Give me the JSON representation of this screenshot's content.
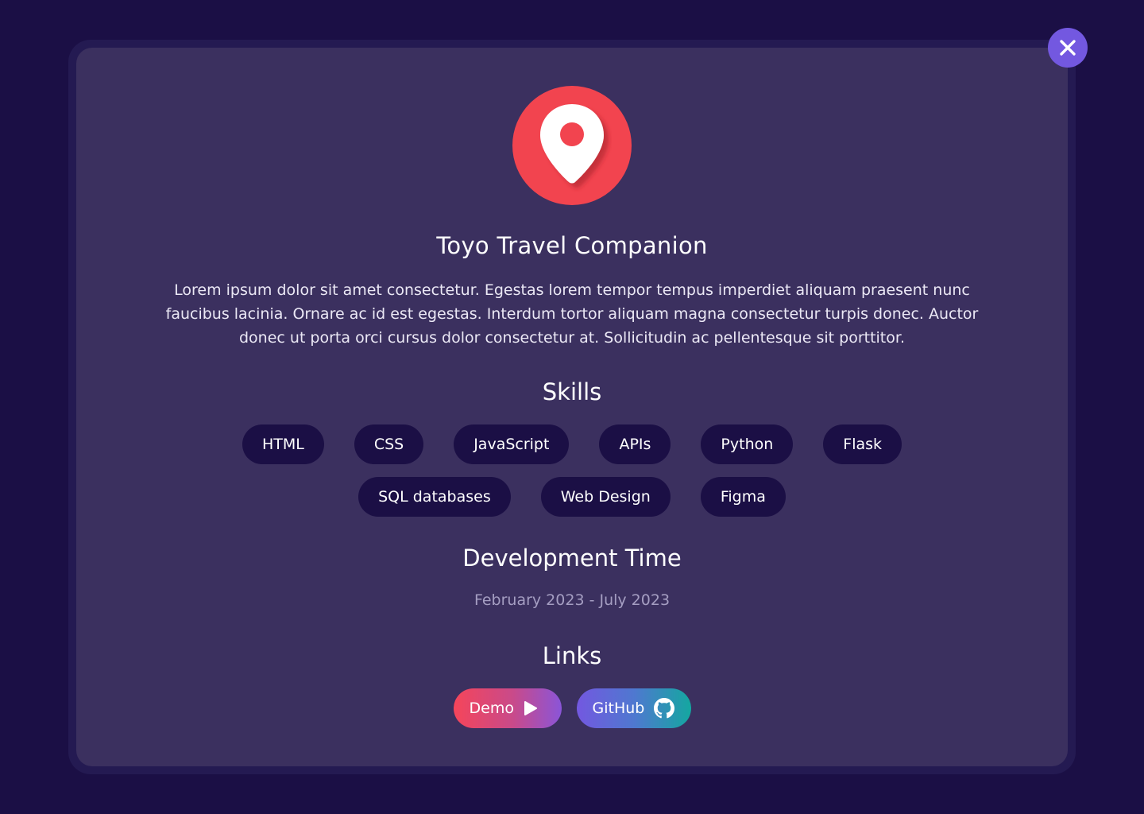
{
  "project": {
    "title": "Toyo Travel Companion",
    "description": "Lorem ipsum dolor sit amet consectetur. Egestas lorem tempor tempus imperdiet aliquam praesent nunc faucibus lacinia. Ornare ac id est egestas. Interdum tortor aliquam magna consectetur turpis donec. Auctor donec ut porta orci cursus dolor consectetur at. Sollicitudin ac pellentesque sit porttitor.",
    "logo_icon": "map-pin-icon"
  },
  "skills": {
    "heading": "Skills",
    "row1": [
      "HTML",
      "CSS",
      "JavaScript",
      "APIs",
      "Python",
      "Flask"
    ],
    "row2": [
      "SQL databases",
      "Web Design",
      "Figma"
    ]
  },
  "development": {
    "heading": "Development Time",
    "period": "February 2023 - July 2023"
  },
  "links": {
    "heading": "Links",
    "demo_label": "Demo",
    "github_label": "GitHub"
  },
  "colors": {
    "page_background": "#1b0f45",
    "modal_background": "#3b305f",
    "accent": "#7358e0",
    "logo_red": "#f2444f",
    "chip_background": "#1b0f45"
  },
  "icons": {
    "close": "close-icon",
    "demo": "play-icon",
    "github": "github-icon"
  }
}
